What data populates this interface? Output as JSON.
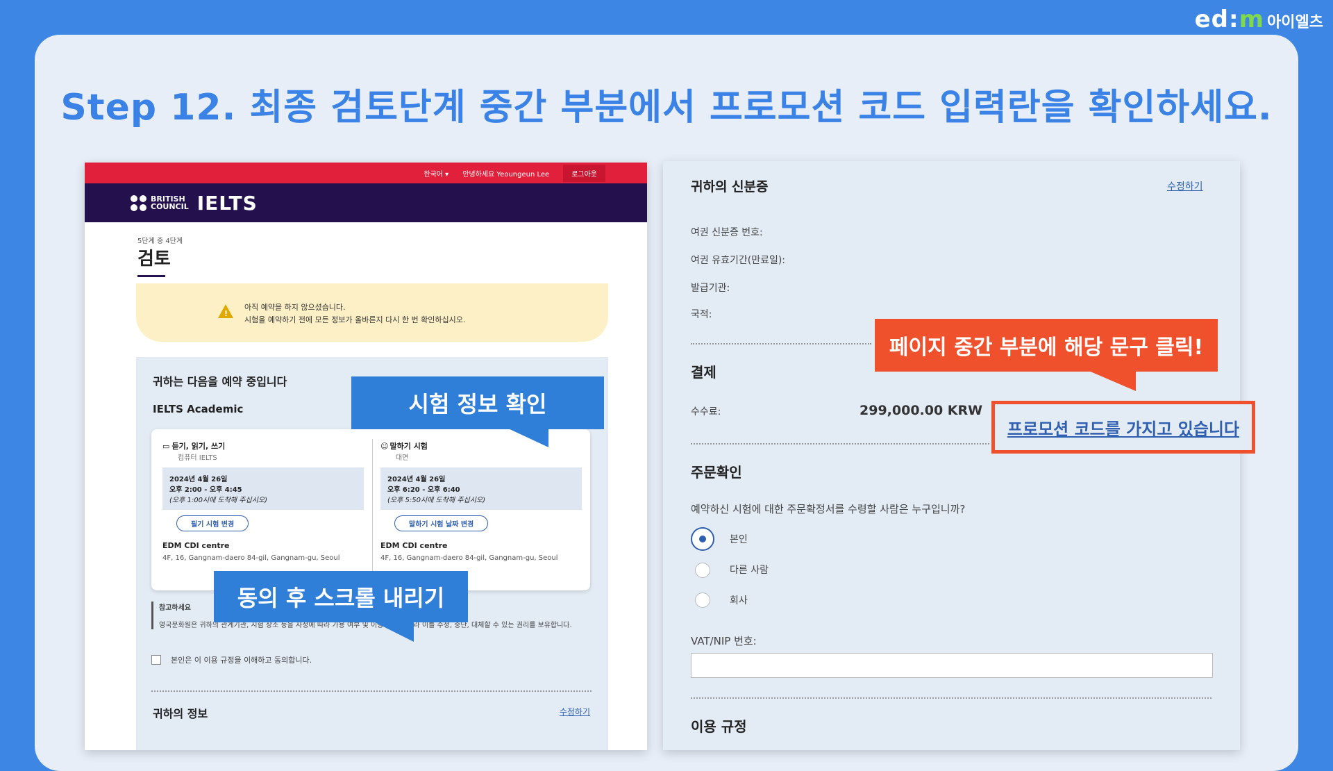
{
  "brand": {
    "ed": "ed:",
    "m": "m",
    "kor": "아이엘츠"
  },
  "title": "Step 12. 최종 검토단계 중간 부분에서 프로모션 코드 입력란을 확인하세요.",
  "left": {
    "topbar": {
      "lang": "한국어 ▾",
      "greeting": "안녕하세요 Yeoungeun Lee",
      "logout": "로그아웃"
    },
    "header": {
      "bc_line1": "BRITISH",
      "bc_line2": "COUNCIL",
      "ielts": "IELTS"
    },
    "step": "5단계 중 4단계",
    "page_title": "검토",
    "warning": {
      "line1": "아직 예약을 하지 않으셨습니다.",
      "line2": "시험을 예약하기 전에 모든 정보가 올바른지 다시 한 번 확인하십시오."
    },
    "booking": {
      "heading": "귀하는 다음을 예약 중입니다",
      "exam_type": "IELTS Academic",
      "written": {
        "name": "듣기, 읽기, 쓰기",
        "mode": "컴퓨터 IELTS",
        "date": "2024년 4월 26일",
        "time": "오후 2:00 - 오후 4:45",
        "arrive": "(오후 1:00시에 도착해 주십시오)",
        "button": "필기 시험 변경",
        "venue": "EDM CDI centre",
        "address": "4F, 16, Gangnam-daero 84-gil, Gangnam-gu, Seoul"
      },
      "speaking": {
        "name": "말하기 시험",
        "mode": "대면",
        "date": "2024년 4월 26일",
        "time": "오후 6:20 - 오후 6:40",
        "arrive": "(오후 5:50시에 도착해 주십시오)",
        "button": "말하기 시험 날짜 변경",
        "venue": "EDM CDI centre",
        "address": "4F, 16, Gangnam-daero 84-gil, Gangnam-gu, Seoul"
      },
      "note_title": "참고하세요",
      "note_text": "영국문화원은 귀하의 관계기관, 시험 장소 등을 사정에 따라 가용 여부 및 이용 규정에 따라 이를 수정, 중단, 대체할 수 있는 권리를 보유합니다.",
      "agree": "본인은 이 이용 규정을 이해하고 동의합니다.",
      "info_heading": "귀하의 정보",
      "edit": "수정하기"
    },
    "callout_exam": "시험 정보 확인",
    "callout_scroll": "동의 후 스크롤 내리기"
  },
  "right": {
    "id_heading": "귀하의 신분증",
    "edit": "수정하기",
    "passport_no": "여권 신분증 번호:",
    "passport_exp": "여권 유효기간(만료일):",
    "issuer": "발급기관:",
    "nationality": "국적:",
    "payment_heading": "결제",
    "fee_label": "수수료:",
    "fee_value": "299,000.00 KRW",
    "promo": "프로모션 코드를 가지고 있습니다",
    "confirm_heading": "주문확인",
    "confirm_question": "예약하신 시험에 대한 주문확정서를 수령할 사람은 누구입니까?",
    "options": [
      "본인",
      "다른 사람",
      "회사"
    ],
    "vat_label": "VAT/NIP 번호:",
    "terms_heading": "이용 규정",
    "callout_click": "페이지 중간 부분에 해당 문구 클릭!"
  },
  "colors": {
    "bg": "#3d86e4",
    "callout_blue": "#2f7fd8",
    "callout_red": "#f0512d",
    "ielts_purple": "#23104d",
    "bc_red": "#e1213b"
  }
}
